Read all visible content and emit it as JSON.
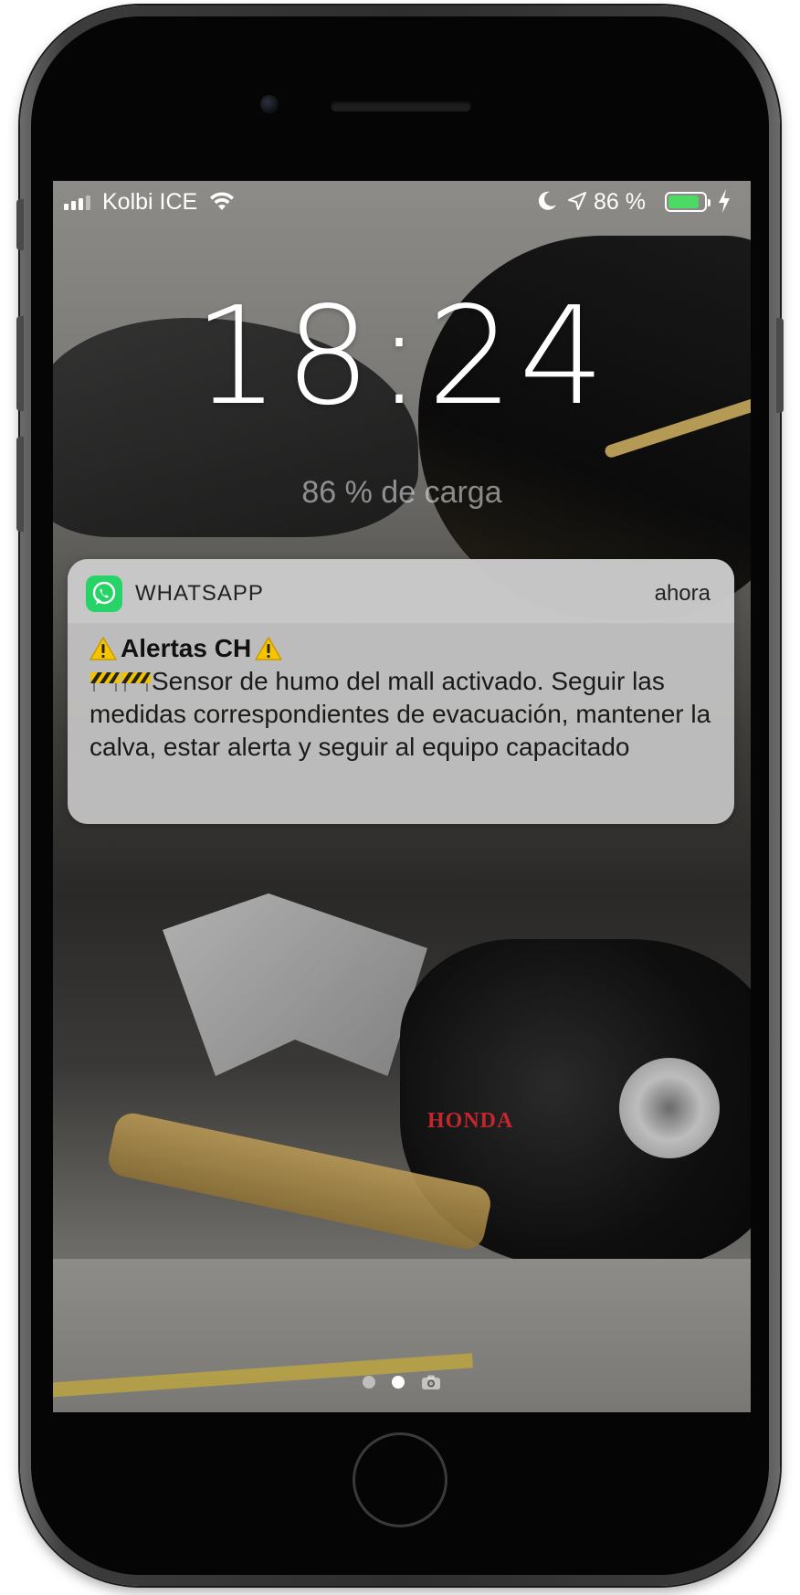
{
  "status_bar": {
    "carrier": "Kolbi ICE",
    "battery_percent_text": "86 %",
    "battery_level": 0.86,
    "icons": [
      "signal-icon",
      "wifi-icon",
      "moon-icon",
      "location-arrow-icon",
      "battery-icon",
      "charging-bolt-icon"
    ]
  },
  "lock_screen": {
    "time": "18:24",
    "charging_text": "86 % de carga"
  },
  "notification": {
    "app_name": "WHATSAPP",
    "time": "ahora",
    "title": "Alertas CH",
    "body": "Sensor de humo del mall activado. Seguir las medidas correspondientes de evacuación, mantener la calva, estar alerta y seguir al equipo capacitado",
    "title_icons": [
      "warning-icon",
      "warning-icon"
    ],
    "body_icons": [
      "construction-tape-icon",
      "construction-tape-icon"
    ]
  },
  "wallpaper": {
    "brand_text": "HONDA"
  },
  "page_indicator": {
    "pages": 2,
    "active_page": 2,
    "icons": [
      "camera-icon"
    ]
  },
  "colors": {
    "battery_fill": "#4cd964",
    "whatsapp_green": "#25d366",
    "warning_yellow": "#f6c500",
    "honda_red": "#c2272d"
  }
}
